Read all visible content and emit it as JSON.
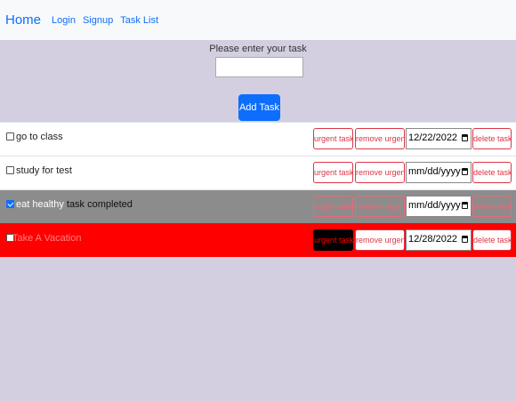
{
  "nav": {
    "brand": "Home",
    "links": [
      "Login",
      "Signup",
      "Task List"
    ]
  },
  "form": {
    "prompt": "Please enter your task",
    "input_value": "",
    "add_label": "Add Task"
  },
  "buttons": {
    "urgent": "urgent task",
    "remove_urgent": "remove urgent",
    "delete": "delete task"
  },
  "tasks": [
    {
      "text": "go to class",
      "completed_note": "",
      "checked": false,
      "date": "12/22/2022",
      "urgent": false
    },
    {
      "text": "study for test",
      "completed_note": "",
      "checked": false,
      "date": "mm/dd/yyyy",
      "urgent": false
    },
    {
      "text": "eat healthy",
      "completed_note": " task completed",
      "checked": true,
      "date": "mm/dd/yyyy",
      "urgent": false
    },
    {
      "text": "Take A Vacation",
      "completed_note": "",
      "checked": false,
      "date": "12/28/2022",
      "urgent": true
    }
  ],
  "colors": {
    "background": "#d3cfe0",
    "primary": "#0d6efd",
    "danger": "#dc3545",
    "completed_row": "#8c8c8c",
    "urgent_row": "#ff0000"
  }
}
